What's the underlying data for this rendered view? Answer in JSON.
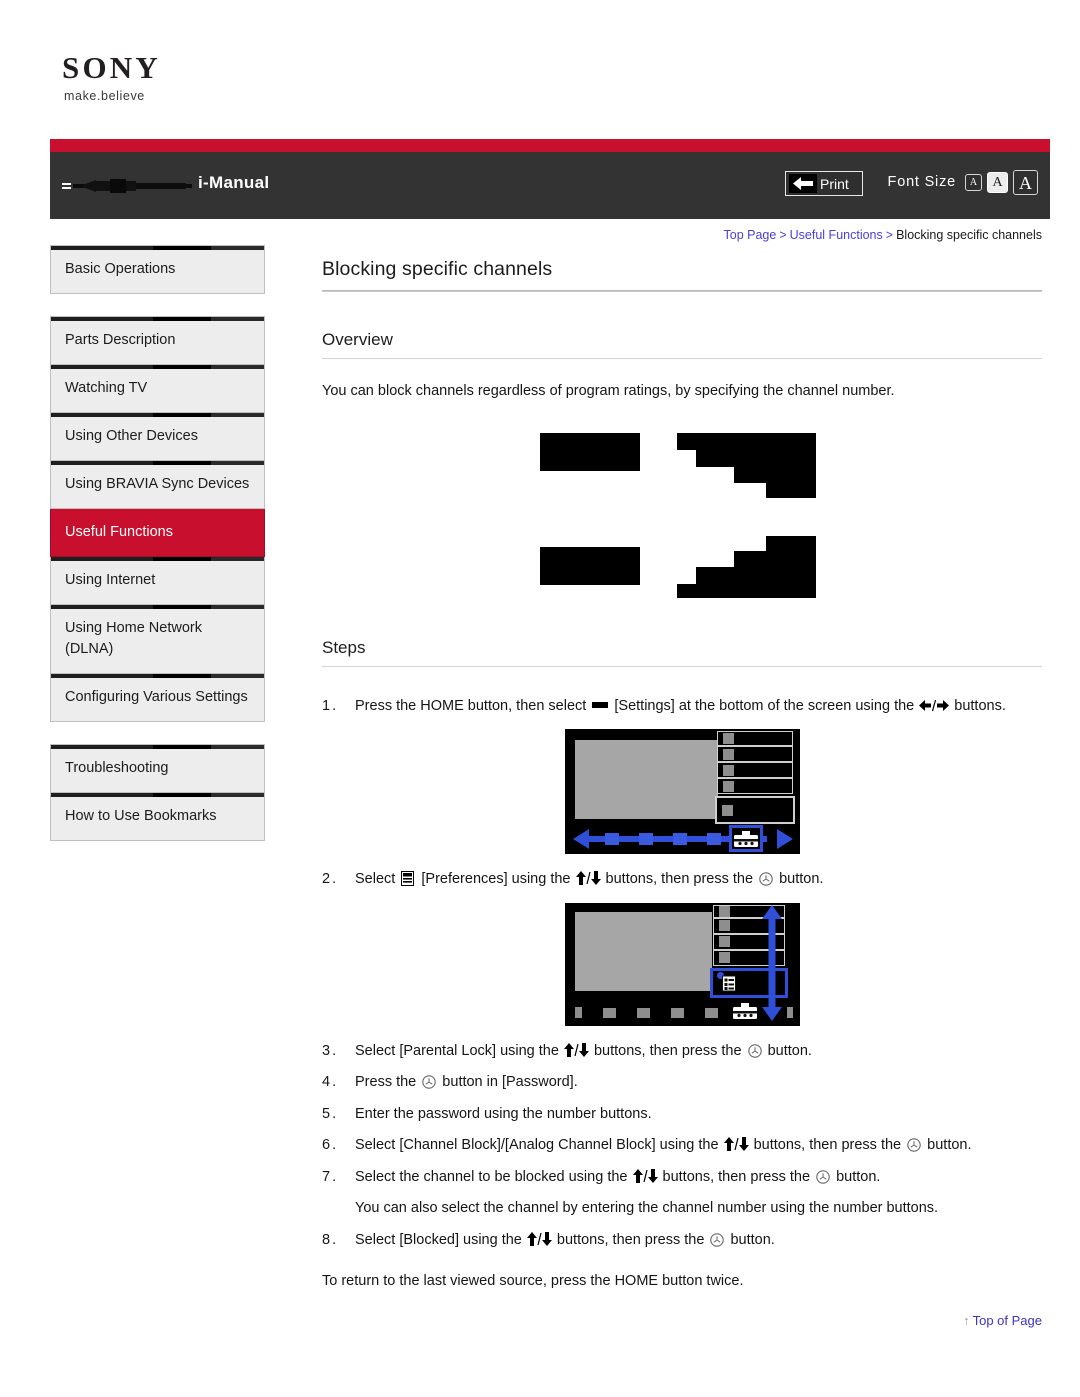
{
  "brand": {
    "name": "SONY",
    "tagline": "make.believe"
  },
  "header": {
    "app_title": "i-Manual",
    "print_label": "Print",
    "print_icon": "print-arrow-icon",
    "font_size_label": "Font Size",
    "font_sizes": [
      {
        "label": "A",
        "size": "small",
        "selected": false
      },
      {
        "label": "A",
        "size": "medium",
        "selected": true
      },
      {
        "label": "A",
        "size": "large",
        "selected": false
      }
    ],
    "bar_color": "#c8102e",
    "background": "#333333"
  },
  "breadcrumb": {
    "items": [
      {
        "label": "Top Page",
        "link": true
      },
      {
        "label": "Useful Functions",
        "link": true
      },
      {
        "label": "Blocking specific channels",
        "link": false
      }
    ],
    "separator": ">"
  },
  "sidebar": {
    "active_color": "#c8102e",
    "groups": [
      {
        "items": [
          {
            "label": "Basic Operations",
            "active": false
          }
        ]
      },
      {
        "items": [
          {
            "label": "Parts Description",
            "active": false
          },
          {
            "label": "Watching TV",
            "active": false
          },
          {
            "label": "Using Other Devices",
            "active": false
          },
          {
            "label": "Using  BRAVIA  Sync Devices",
            "active": false
          },
          {
            "label": "Useful Functions",
            "active": true
          },
          {
            "label": "Using Internet",
            "active": false
          },
          {
            "label": "Using Home Network (DLNA)",
            "active": false
          },
          {
            "label": "Configuring Various Settings",
            "active": false
          }
        ]
      },
      {
        "items": [
          {
            "label": "Troubleshooting",
            "active": false
          },
          {
            "label": "How to Use Bookmarks",
            "active": false
          }
        ]
      }
    ]
  },
  "main": {
    "title": "Blocking specific channels",
    "overview": {
      "heading": "Overview",
      "text": "You can block channels regardless of program ratings, by specifying the channel number."
    },
    "steps_heading": "Steps",
    "steps": [
      {
        "num": "1.",
        "parts": [
          {
            "type": "text",
            "value": "Press the HOME button, then select "
          },
          {
            "type": "icon",
            "value": "settings-bar-icon"
          },
          {
            "type": "text",
            "value": " [Settings] at the bottom of the screen using the "
          },
          {
            "type": "icon",
            "value": "left-right-arrows-icon"
          },
          {
            "type": "text",
            "value": " buttons."
          }
        ],
        "plain": "Press the HOME button, then select [Settings] at the bottom of the screen using the left/right buttons."
      },
      {
        "num": "2.",
        "parts": [
          {
            "type": "text",
            "value": "Select "
          },
          {
            "type": "icon",
            "value": "preferences-icon"
          },
          {
            "type": "text",
            "value": " [Preferences] using the "
          },
          {
            "type": "icon",
            "value": "up-down-arrows-icon"
          },
          {
            "type": "text",
            "value": " buttons, then press the "
          },
          {
            "type": "icon",
            "value": "enter-button-icon"
          },
          {
            "type": "text",
            "value": " button."
          }
        ],
        "plain": "Select [Preferences] using the up/down buttons, then press the enter button."
      },
      {
        "num": "3.",
        "parts": [
          {
            "type": "text",
            "value": "Select [Parental Lock] using the "
          },
          {
            "type": "icon",
            "value": "up-down-arrows-icon"
          },
          {
            "type": "text",
            "value": " buttons, then press the "
          },
          {
            "type": "icon",
            "value": "enter-button-icon"
          },
          {
            "type": "text",
            "value": " button."
          }
        ],
        "plain": "Select [Parental Lock] using the up/down buttons, then press the enter button."
      },
      {
        "num": "4.",
        "parts": [
          {
            "type": "text",
            "value": "Press the "
          },
          {
            "type": "icon",
            "value": "enter-button-icon"
          },
          {
            "type": "text",
            "value": " button in [Password]."
          }
        ],
        "plain": "Press the enter button in [Password]."
      },
      {
        "num": "5.",
        "parts": [
          {
            "type": "text",
            "value": "Enter the password using the number buttons."
          }
        ],
        "plain": "Enter the password using the number buttons."
      },
      {
        "num": "6.",
        "parts": [
          {
            "type": "text",
            "value": "Select [Channel Block]/[Analog Channel Block] using the "
          },
          {
            "type": "icon",
            "value": "up-down-arrows-icon"
          },
          {
            "type": "text",
            "value": " buttons, then press the "
          },
          {
            "type": "icon",
            "value": "enter-button-icon"
          },
          {
            "type": "text",
            "value": " button."
          }
        ],
        "plain": "Select [Channel Block]/[Analog Channel Block] using the up/down buttons, then press the enter button."
      },
      {
        "num": "7.",
        "parts": [
          {
            "type": "text",
            "value": "Select the channel to be blocked using the "
          },
          {
            "type": "icon",
            "value": "up-down-arrows-icon"
          },
          {
            "type": "text",
            "value": " buttons, then press the "
          },
          {
            "type": "icon",
            "value": "enter-button-icon"
          },
          {
            "type": "text",
            "value": " button."
          }
        ],
        "plain": "Select the channel to be blocked using the up/down buttons, then press the enter button.",
        "note": "You can also select the channel by entering the channel number using the number buttons."
      },
      {
        "num": "8.",
        "parts": [
          {
            "type": "text",
            "value": "Select [Blocked] using the "
          },
          {
            "type": "icon",
            "value": "up-down-arrows-icon"
          },
          {
            "type": "text",
            "value": " buttons, then press the "
          },
          {
            "type": "icon",
            "value": "enter-button-icon"
          },
          {
            "type": "text",
            "value": " button."
          }
        ],
        "plain": "Select [Blocked] using the up/down buttons, then press the enter button."
      }
    ],
    "closing_text": "To return to the last viewed source, press the HOME button twice."
  },
  "footer": {
    "top_of_page_label": "Top of Page",
    "top_of_page_arrow": "up-arrow-icon"
  }
}
